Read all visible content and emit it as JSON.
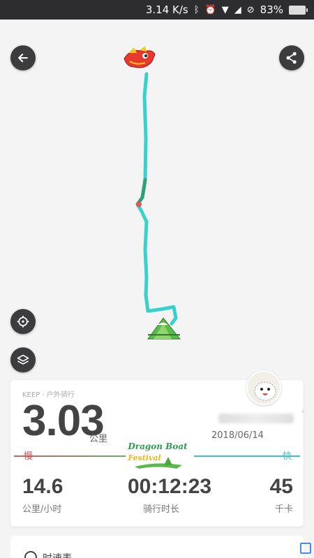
{
  "status_bar": {
    "speed": "3.14 K/s",
    "battery": "83%"
  },
  "map": {
    "icons": {
      "back": "arrow-left-icon",
      "share": "share-icon",
      "locate": "crosshair-icon",
      "layers": "layers-icon"
    },
    "route_colors": {
      "main": "#37d2cc",
      "segment": "#2fa07a",
      "slow": "#e0585a"
    }
  },
  "summary": {
    "brand": "KEEP · 户外骑行",
    "distance": "3.03",
    "distance_unit": "公里",
    "date": "2018/06/14",
    "slow_label": "慢",
    "fast_label": "快",
    "festival_line1": "Dragon Boat",
    "festival_line2": "Festival",
    "stats": [
      {
        "value": "14.6",
        "label": "公里/小时"
      },
      {
        "value": "00:12:23",
        "label": "骑行时长"
      },
      {
        "value": "45",
        "label": "千卡"
      }
    ]
  },
  "next_section": {
    "label": "时速表"
  }
}
